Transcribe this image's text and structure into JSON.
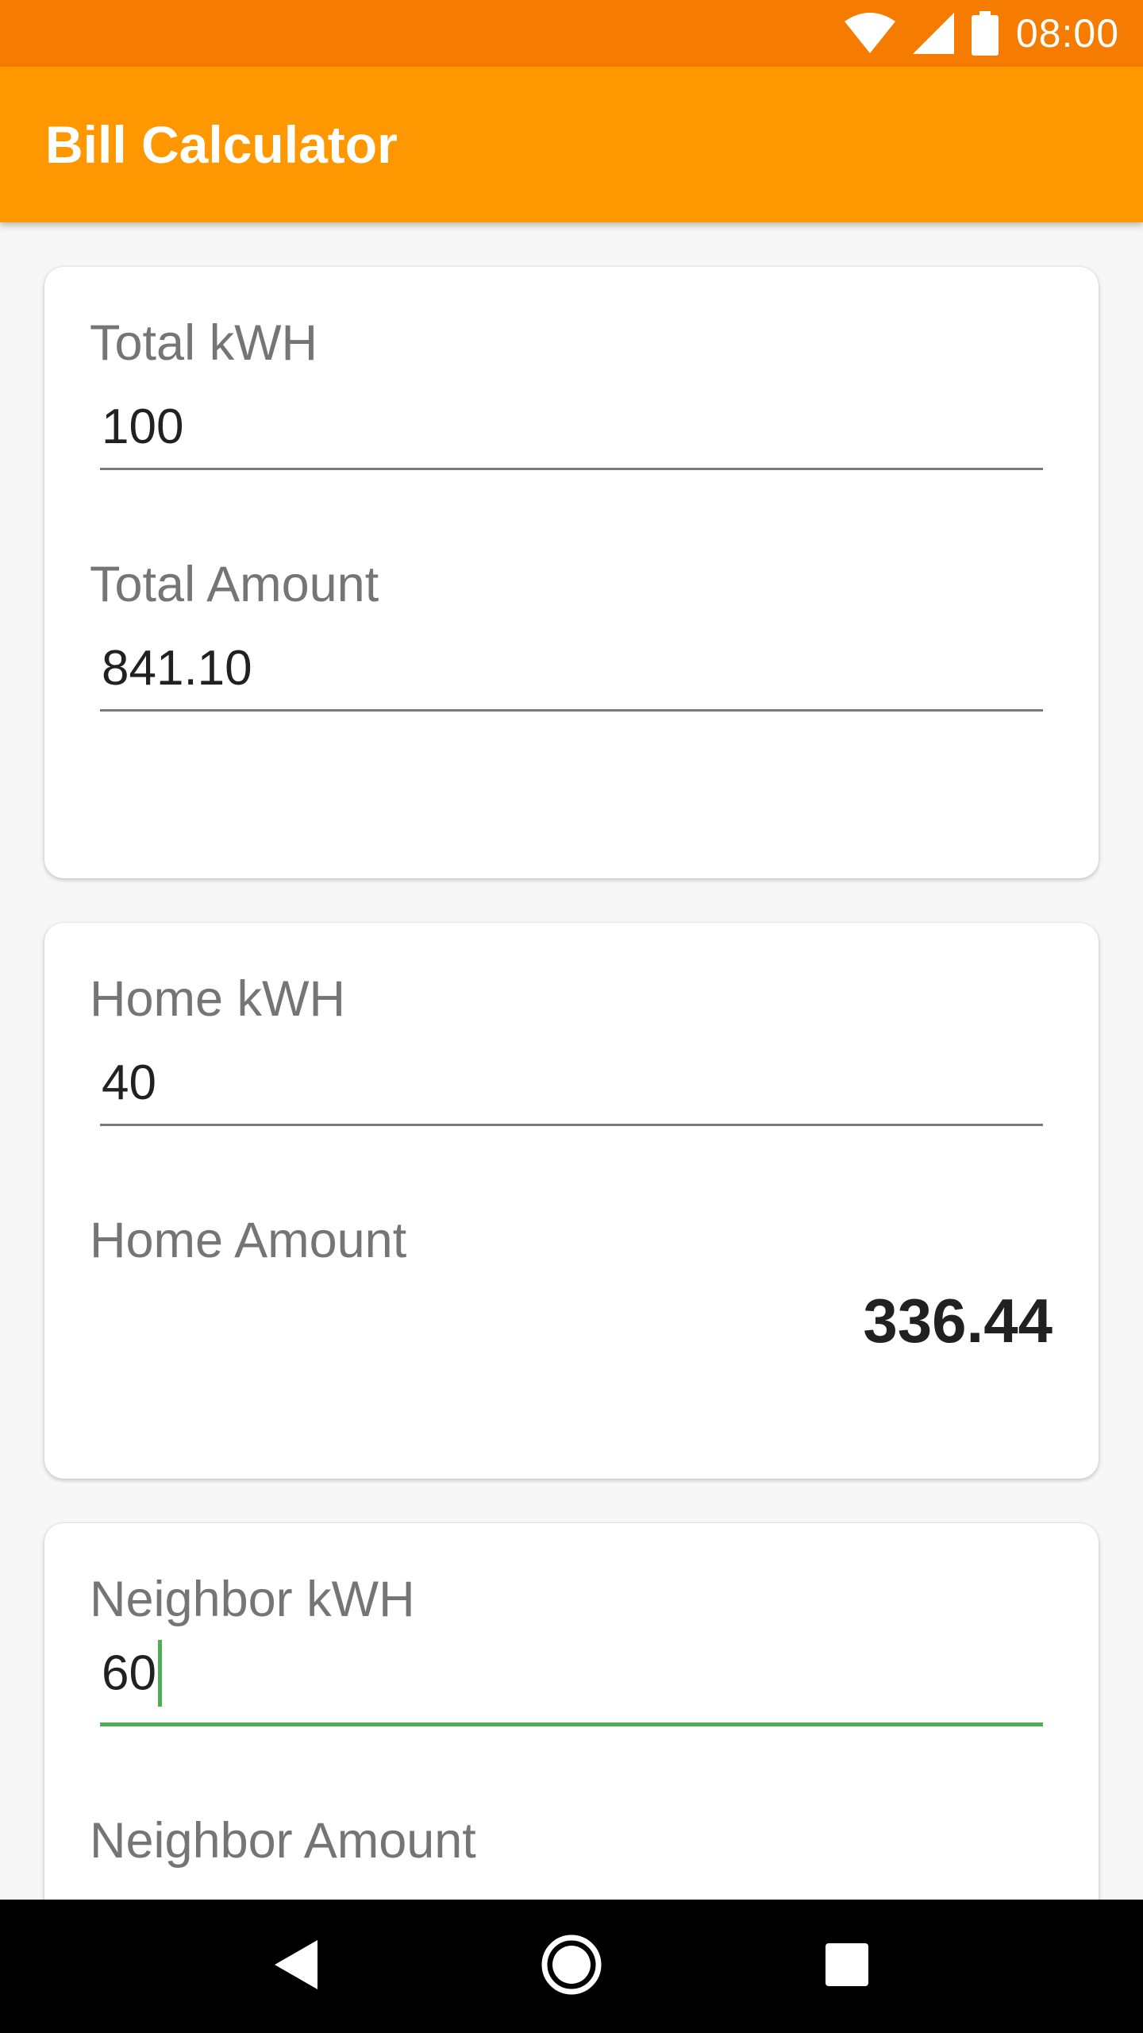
{
  "status_bar": {
    "time": "08:00"
  },
  "app_bar": {
    "title": "Bill Calculator"
  },
  "total_card": {
    "kwh_label": "Total kWH",
    "kwh_value": "100",
    "amount_label": "Total Amount",
    "amount_value": "841.10"
  },
  "home_card": {
    "kwh_label": "Home kWH",
    "kwh_value": "40",
    "amount_label": "Home Amount",
    "amount_value": "336.44"
  },
  "neighbor_card": {
    "kwh_label": "Neighbor kWH",
    "kwh_value": "60",
    "amount_label": "Neighbor Amount"
  },
  "colors": {
    "status_bar": "#f57c00",
    "app_bar": "#ff9800",
    "focus_accent": "#4caf50"
  },
  "icons": [
    "wifi-icon",
    "cellular-signal-icon",
    "battery-icon",
    "back-icon",
    "home-icon",
    "recents-icon"
  ]
}
